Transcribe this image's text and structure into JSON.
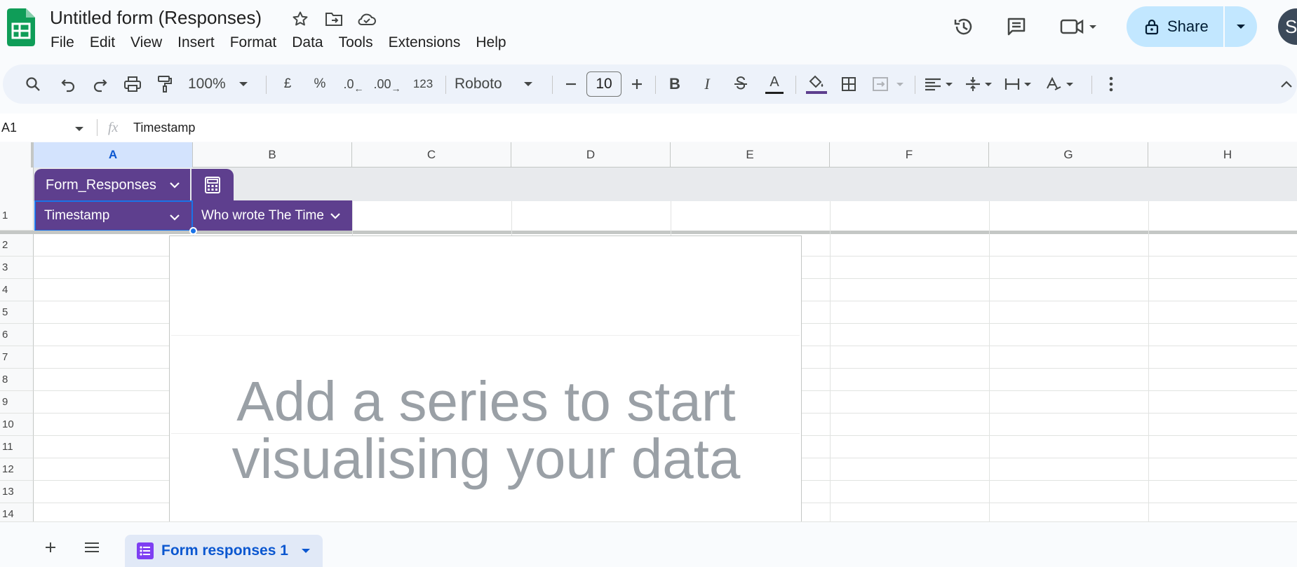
{
  "app": {
    "title": "Untitled form (Responses)",
    "menu": [
      "File",
      "Edit",
      "View",
      "Insert",
      "Format",
      "Data",
      "Tools",
      "Extensions",
      "Help"
    ],
    "share_label": "Share",
    "avatar_initial": "S",
    "brand_color": "#0f9d58"
  },
  "toolbar": {
    "zoom": "100%",
    "currency": "£",
    "percent": "%",
    "decrease_decimal": ".0",
    "increase_decimal": ".00",
    "number_format": "123",
    "font": "Roboto",
    "font_size": "10",
    "bold": "B",
    "italic": "I",
    "text_color": "A",
    "text_color_bar": "#1f1f1f",
    "fill_color_bar": "#5e3f8e"
  },
  "formula_bar": {
    "cell_ref": "A1",
    "fx": "fx",
    "value": "Timestamp"
  },
  "grid": {
    "columns": [
      "A",
      "B",
      "C",
      "D",
      "E",
      "F",
      "G",
      "H"
    ],
    "rows": [
      "1",
      "2",
      "3",
      "4",
      "5",
      "6",
      "7",
      "8",
      "9",
      "10",
      "11",
      "12",
      "13",
      "14"
    ],
    "table_name": "Form_Responses",
    "table_color": "#5e3f8e",
    "headers": [
      "Timestamp",
      "Who wrote The Time"
    ]
  },
  "chart": {
    "message_line1": "Add a series to start",
    "message_line2": "visualising your data"
  },
  "sheets": {
    "active_tab": "Form responses 1"
  }
}
